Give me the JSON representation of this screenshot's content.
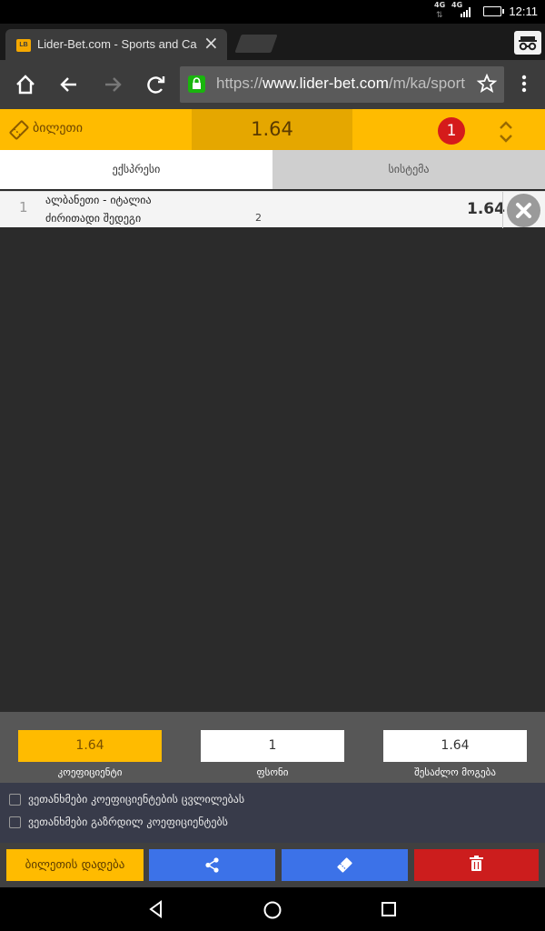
{
  "status_bar": {
    "net1": "4G",
    "net2": "4G",
    "time": "12:11"
  },
  "browser": {
    "tab_title": "Lider-Bet.com - Sports and Ca",
    "tab_favicon": "LB",
    "url_scheme": "https://",
    "url_domain": "www.lider-bet.com",
    "url_path": "/m/ka/sport"
  },
  "slip": {
    "label": "ბილეთი",
    "total_odds": "1.64",
    "count": "1",
    "tabs": [
      "ექსპრესი",
      "სისტემა"
    ]
  },
  "bets": [
    {
      "index": "1",
      "match": "ალბანეთი - იტალია",
      "market": "ძირითადი შედეგი",
      "pick": "2",
      "odds": "1.64"
    }
  ],
  "summary": {
    "coefficient_value": "1.64",
    "coefficient_label": "კოეფიციენტი",
    "stake_value": "1",
    "stake_label": "ფსონი",
    "win_value": "1.64",
    "win_label": "შესაძლო მოგება"
  },
  "options": {
    "accept_changes": "ვეთანხმები კოეფიციენტების ცვლილებას",
    "accept_increased": "ვეთანხმები გაზრდილ კოეფიციენტებს"
  },
  "actions": {
    "place_label": "ბილეთის დადება"
  },
  "colors": {
    "accent": "#ffbb00",
    "accent_dark": "#e5a700",
    "blue": "#3c72e8",
    "red": "#cc1d1d"
  }
}
